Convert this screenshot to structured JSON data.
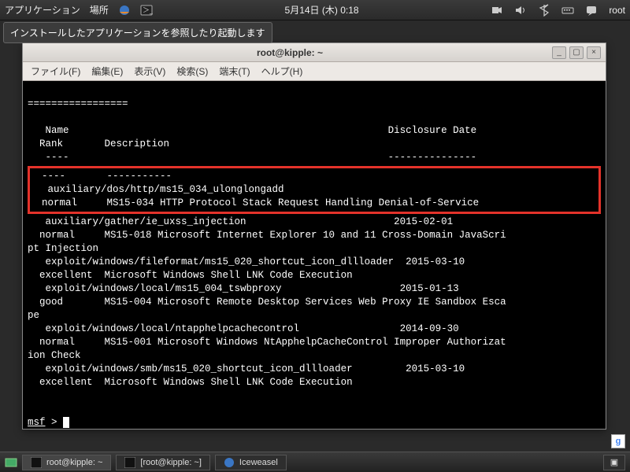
{
  "topbar": {
    "applications": "アプリケーション",
    "places": "場所",
    "datetime": "5月14日 (木)  0:18",
    "user": "root",
    "tooltip": "インストールしたアプリケーションを参照したり起動します"
  },
  "window": {
    "title": "root@kipple: ~",
    "menus": {
      "file": "ファイル(F)",
      "edit": "編集(E)",
      "view": "表示(V)",
      "search": "検索(S)",
      "terminal": "端末(T)",
      "help": "ヘルプ(H)"
    },
    "winbtns": {
      "min": "_",
      "max": "▢",
      "close": "×"
    }
  },
  "term": {
    "divider": "=================",
    "header1": "   Name                                                      Disclosure Date",
    "header2": "  Rank       Description",
    "dash1": "   ----                                                      ---------------",
    "highlight": {
      "dash2": "  ----       -----------",
      "line1": "   auxiliary/dos/http/ms15_034_ulonglongadd",
      "line2": "  normal     MS15-034 HTTP Protocol Stack Request Handling Denial-of-Service"
    },
    "lines": [
      "   auxiliary/gather/ie_uxss_injection                         2015-02-01",
      "  normal     MS15-018 Microsoft Internet Explorer 10 and 11 Cross-Domain JavaScri",
      "pt Injection",
      "   exploit/windows/fileformat/ms15_020_shortcut_icon_dllloader  2015-03-10",
      "  excellent  Microsoft Windows Shell LNK Code Execution",
      "   exploit/windows/local/ms15_004_tswbproxy                    2015-01-13",
      "  good       MS15-004 Microsoft Remote Desktop Services Web Proxy IE Sandbox Esca",
      "pe",
      "   exploit/windows/local/ntapphelpcachecontrol                 2014-09-30",
      "  normal     MS15-001 Microsoft Windows NtApphelpCacheControl Improper Authorizat",
      "ion Check",
      "   exploit/windows/smb/ms15_020_shortcut_icon_dllloader         2015-03-10",
      "  excellent  Microsoft Windows Shell LNK Code Execution"
    ],
    "prompt_label": "msf",
    "prompt_sep": " > "
  },
  "taskbar": {
    "items": [
      {
        "label": "root@kipple: ~"
      },
      {
        "label": "[root@kipple: ~]"
      },
      {
        "label": "Iceweasel"
      }
    ],
    "launcher_icon": "▣"
  },
  "gbadge": "g"
}
